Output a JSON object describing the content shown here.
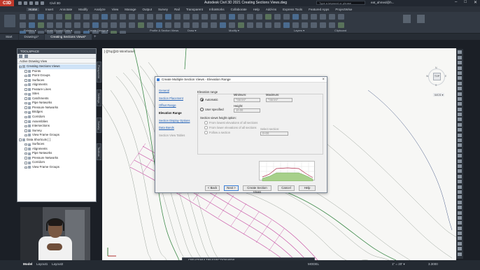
{
  "app": {
    "title": "Autodesk Civil 3D 2021  Creating Sections Views.dwg",
    "app_button": "C3D",
    "workspace": "Civil 3D",
    "search_placeholder": "Type a keyword or phrase",
    "user": "eat_ahmed@h..."
  },
  "menu_tabs": [
    "Home",
    "Insert",
    "Annotate",
    "Modify",
    "Analyze",
    "View",
    "Manage",
    "Output",
    "Survey",
    "Rail",
    "Transparent",
    "InfraWorks",
    "Collaborate",
    "Help",
    "Add-ins",
    "Express Tools",
    "Featured Apps",
    "ProjectWise"
  ],
  "ribbon_panels": [
    {
      "label": "Palettes ▾"
    },
    {
      "label": "Create Ground Data ▾"
    },
    {
      "label": "Create Design ▾"
    },
    {
      "label": "Profile & Section Views"
    },
    {
      "label": "Draw ▾"
    },
    {
      "label": "Modify ▾"
    },
    {
      "label": "Layers ▾"
    },
    {
      "label": "Clipboard"
    }
  ],
  "doc_tabs": [
    "Start",
    "Drawing1*",
    "Creating Sections Views*"
  ],
  "toolspace": {
    "title": "TOOLSPACE",
    "filter": "Active Drawing View",
    "tree": [
      {
        "label": "Creating Sections Views",
        "level": 0,
        "selected": true
      },
      {
        "label": "Points",
        "level": 1
      },
      {
        "label": "Point Groups",
        "level": 1
      },
      {
        "label": "Surfaces",
        "level": 1
      },
      {
        "label": "Alignments",
        "level": 1
      },
      {
        "label": "Feature Lines",
        "level": 1
      },
      {
        "label": "Sites",
        "level": 1
      },
      {
        "label": "Catchments",
        "level": 1
      },
      {
        "label": "Pipe Networks",
        "level": 1
      },
      {
        "label": "Pressure Networks",
        "level": 1
      },
      {
        "label": "Bridges",
        "level": 1
      },
      {
        "label": "Corridors",
        "level": 1
      },
      {
        "label": "Assemblies",
        "level": 1
      },
      {
        "label": "Intersections",
        "level": 1
      },
      {
        "label": "Survey",
        "level": 1
      },
      {
        "label": "View Frame Groups",
        "level": 1
      },
      {
        "label": "Data Shortcuts [ ]",
        "level": 0
      },
      {
        "label": "Surfaces",
        "level": 1
      },
      {
        "label": "Alignments",
        "level": 1
      },
      {
        "label": "Pipe Networks",
        "level": 1
      },
      {
        "label": "Pressure Networks",
        "level": 1
      },
      {
        "label": "Corridors",
        "level": 1
      },
      {
        "label": "View Frame Groups",
        "level": 1
      }
    ],
    "side_tabs": [
      "Prospector",
      "Settings",
      "Survey",
      "Toolbox"
    ]
  },
  "viewport_label": "[-][Top][2D Wireframe]",
  "viewcube": {
    "face": "TOP",
    "n": "N",
    "s": "S",
    "e": "E",
    "w": "W",
    "wcs": "WCS ▾"
  },
  "dialog": {
    "title": "Create Multiple Section Views - Elevation Range",
    "steps": [
      {
        "label": "General",
        "state": "link"
      },
      {
        "label": "Section Placement",
        "state": "link"
      },
      {
        "label": "Offset Range",
        "state": "link"
      },
      {
        "label": "Elevation Range",
        "state": "current"
      },
      {
        "label": "Section Display Options",
        "state": "link"
      },
      {
        "label": "Data Bands",
        "state": "link"
      },
      {
        "label": "Section View Tables",
        "state": "disabled"
      }
    ],
    "elevation_range": "Elevation range",
    "automatic": "Automatic",
    "user_specified": "User specified",
    "minimum_label": "Minimum:",
    "maximum_label": "Maximum:",
    "minimum_value": "*Varies*",
    "maximum_value": "*Varies*",
    "height_label": "Height:",
    "height_value": "10.00",
    "height_option": "Section views height option:",
    "from_lowest": "From lowest elevations of all sections",
    "from_lowest2": "From lower elevations of all sections",
    "follow_section": "Follow a section",
    "select_section": "Select section:",
    "section_value": "0+00",
    "buttons": {
      "back": "< Back",
      "next": "Next >",
      "create": "Create Section Views",
      "cancel": "Cancel",
      "help": "Help"
    }
  },
  "layout_tabs": [
    "Model",
    "Layout1",
    "Layout2"
  ],
  "command_line": "CREATEMULTIPLESECTIONVIEW",
  "status_bar": {
    "model": "MODEL",
    "scale": "1\" = 20' ▾",
    "zoom": "3.3000"
  }
}
